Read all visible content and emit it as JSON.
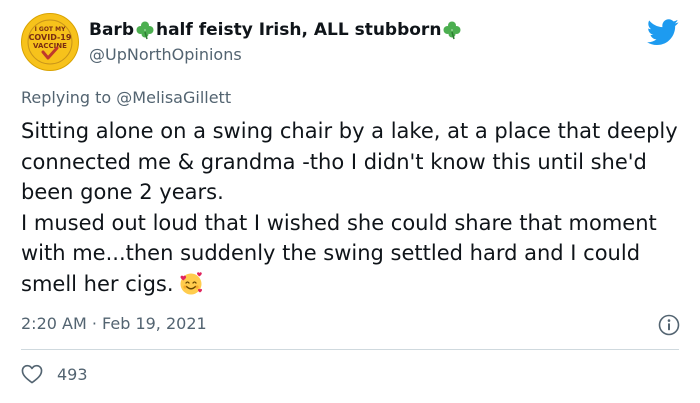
{
  "tweet": {
    "display_name_part1": "Barb",
    "display_name_part2": "half feisty Irish, ALL stubborn",
    "handle": "@UpNorthOpinions",
    "reply_prefix": "Replying to ",
    "reply_to": "@MelisaGillett",
    "text": "Sitting alone on a swing chair by a lake, at a place that deeply connected me & grandma -tho I didn't know this until she'd been gone 2 years.\nI mused out loud that I wished she could share that moment with me...then suddenly the swing settled hard and I could smell her cigs.",
    "timestamp": "2:20 AM · Feb 19, 2021",
    "like_count": "493"
  },
  "avatar": {
    "line1": "I GOT MY",
    "line2": "COVID-19",
    "line3": "VACCINE"
  },
  "icons": {
    "brand": "twitter-bird-icon",
    "emoji": "smiling-face-with-hearts",
    "decoration": "shamrock-icon",
    "info": "info-icon",
    "like": "heart-outline-icon"
  },
  "colors": {
    "brand_blue": "#1d9bf0",
    "shamrock_green": "#4caf50",
    "muted_text": "#536471",
    "avatar_yellow": "#f7c21b"
  }
}
